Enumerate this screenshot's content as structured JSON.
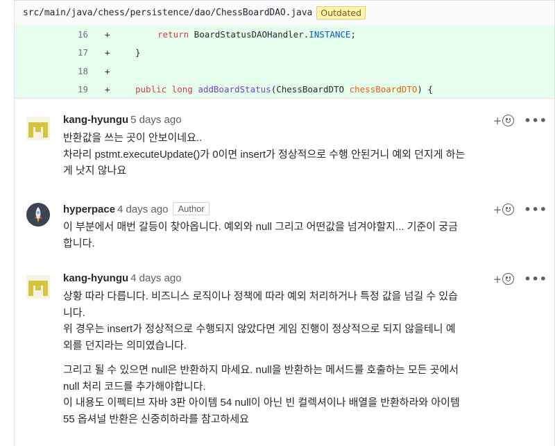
{
  "file": {
    "path": "src/main/java/chess/persistence/dao/ChessBoardDAO.java",
    "badge": "Outdated"
  },
  "diff": {
    "lines": [
      {
        "num": "16",
        "sign": "+"
      },
      {
        "num": "17",
        "sign": "+"
      },
      {
        "num": "18",
        "sign": "+"
      },
      {
        "num": "19",
        "sign": "+"
      }
    ],
    "code": {
      "l16_kw": "return",
      "l16_rest": " BoardStatusDAOHandler.",
      "l16_const": "INSTANCE",
      "l16_end": ";",
      "l17": "}",
      "l19_kw": "public long",
      "l19_fn": "addBoardStatus",
      "l19_mid": "(ChessBoardDTO ",
      "l19_param": "chessBoardDTO",
      "l19_end": ") {"
    }
  },
  "comments": [
    {
      "author": "kang-hyungu",
      "time": "5 days ago",
      "lines": [
        "반환값을 쓰는 곳이 안보이네요..",
        "차라리 pstmt.executeUpdate()가 0이면 insert가 정상적으로 수행 안된거니 예외 던지게 하는",
        "게 낫지 않나요"
      ]
    },
    {
      "author": "hyperpace",
      "time": "4 days ago",
      "badge": "Author",
      "lines": [
        "이 부분에서 매번 갈등이 찾아옵니다. 예외와 null 그리고 어떤값을 넘겨야할지... 기준이 궁금",
        "합니다."
      ]
    },
    {
      "author": "kang-hyungu",
      "time": "4 days ago",
      "lines": [
        "상황 따라 다릅니다. 비즈니스 로직이나 정책에 따라 예외 처리하거나 특정 값을 넘길 수 있습",
        "니다.",
        "위 경우는 insert가 정상적으로 수행되지 않았다면 게임 진행이 정상적으로 되지 않을테니 예",
        "외를 던지라는 의미였습니다."
      ],
      "lines2": [
        "그리고 될 수 있으면 null은 반환하지 마세요. null을 반환하는 메서드를 호출하는 모든 곳에서",
        "null 처리 코드를 추가해야합니다.",
        "이 내용도 이펙티브 자바 3판 아이템 54 null이 아닌 빈 컬렉셔이나 배열을 반환하라와 아이템",
        "55 옵셔널 반환은 신중히하라를 참고하세요"
      ]
    }
  ],
  "actions": {
    "react_plus": "+",
    "more": "•••"
  },
  "colors": {
    "diff_bg": "#e6ffed",
    "identicon": "#d4c442",
    "keyword": "#d73a49",
    "function": "#6f42c1"
  }
}
